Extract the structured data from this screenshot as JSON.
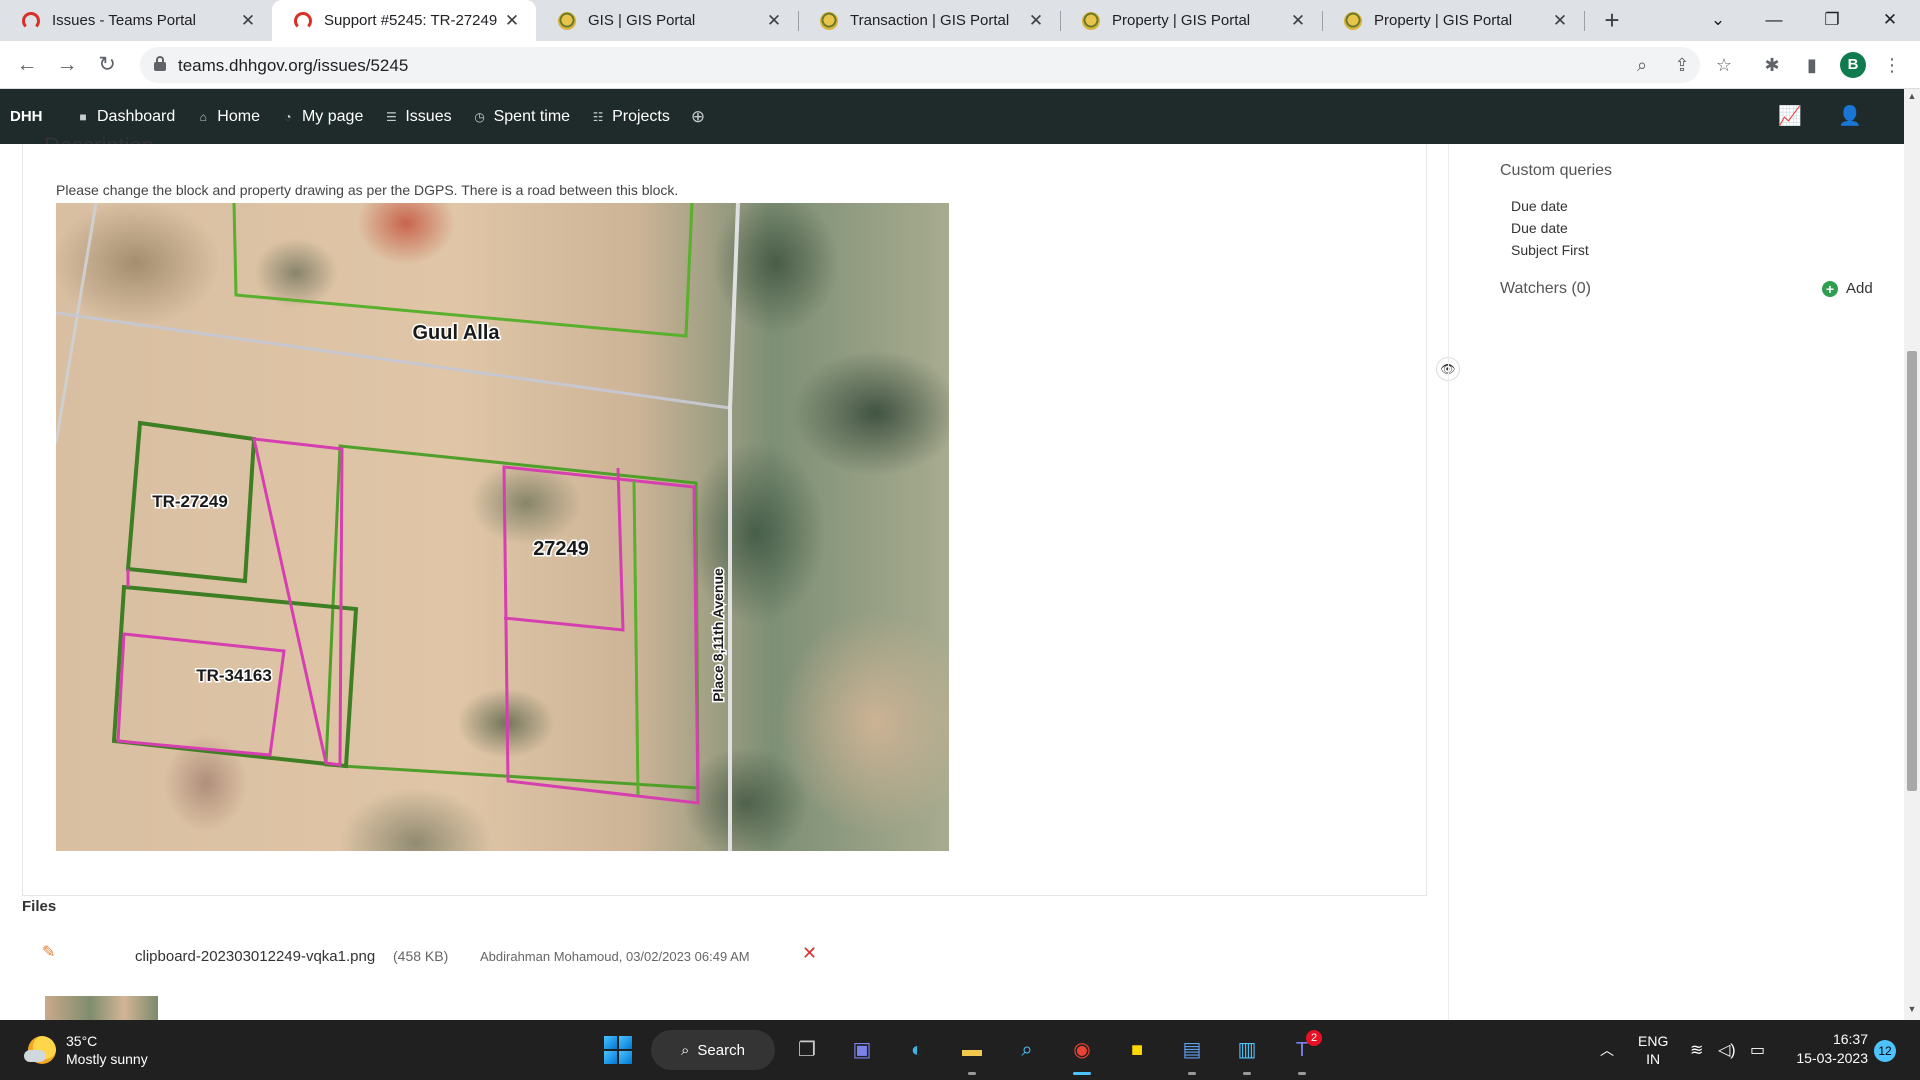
{
  "browser": {
    "tabs": [
      {
        "title": "Issues - Teams Portal",
        "favicon": "teams-portal-icon"
      },
      {
        "title": "Support #5245: TR-27249 -",
        "favicon": "teams-portal-icon",
        "active": true
      },
      {
        "title": "GIS | GIS Portal",
        "favicon": "gis-portal-icon"
      },
      {
        "title": "Transaction | GIS Portal",
        "favicon": "gis-portal-icon"
      },
      {
        "title": "Property | GIS Portal",
        "favicon": "gis-portal-icon"
      },
      {
        "title": "Property | GIS Portal",
        "favicon": "gis-portal-icon"
      }
    ],
    "url": "teams.dhhgov.org/issues/5245",
    "profile_initial": "B"
  },
  "app": {
    "brand": "DHH",
    "menu": [
      {
        "label": "Dashboard",
        "icon": "dashboard-icon"
      },
      {
        "label": "Home",
        "icon": "home-icon"
      },
      {
        "label": "My page",
        "icon": "my-page-icon"
      },
      {
        "label": "Issues",
        "icon": "issues-icon"
      },
      {
        "label": "Spent time",
        "icon": "clock-icon"
      },
      {
        "label": "Projects",
        "icon": "projects-icon"
      }
    ]
  },
  "issue": {
    "section_heading": "Description",
    "description": "Please change the block and property drawing as per the DGPS. There is a road between this block.",
    "map_labels": {
      "area": "Guul Alla",
      "parcel_1": "TR-27249",
      "parcel_2": "27249",
      "parcel_3": "TR-34163",
      "road": "Place 8,11th Avenue"
    },
    "files_heading": "Files",
    "attachment": {
      "name": "clipboard-202303012249-vqka1.png",
      "size": "(458 KB)",
      "author": "Abdirahman Mohamoud, 03/02/2023 06:49 AM"
    }
  },
  "sidebar": {
    "custom_queries_title": "Custom queries",
    "queries": [
      "Due date",
      "Due date",
      "Subject First"
    ],
    "watchers_label": "Watchers (0)",
    "add_label": "Add"
  },
  "taskbar": {
    "temperature": "35°C",
    "weather": "Mostly sunny",
    "search": "Search",
    "lang_1": "ENG",
    "lang_2": "IN",
    "time": "16:37",
    "date": "15-03-2023",
    "notifications": "12",
    "teams_badge": "2"
  },
  "colors": {
    "app_header": "#1f2b2b",
    "parcel_magenta": "#d63fb0",
    "block_green": "#3e7f24"
  }
}
